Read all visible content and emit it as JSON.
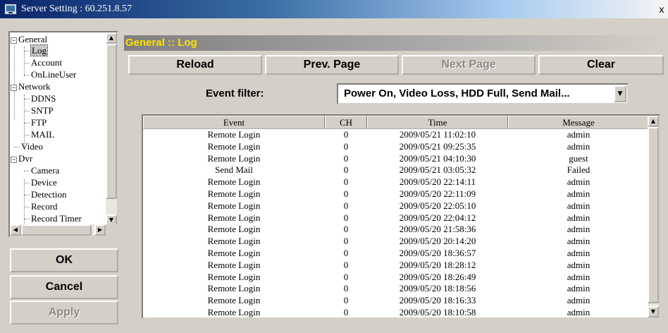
{
  "window": {
    "title": "Server Setting : 60.251.8.57",
    "close_glyph": "x"
  },
  "tree": {
    "nodes": [
      {
        "label": "General",
        "expander": "−"
      },
      {
        "label": "Log"
      },
      {
        "label": "Account"
      },
      {
        "label": "OnLineUser"
      },
      {
        "label": "Network",
        "expander": "−"
      },
      {
        "label": "DDNS"
      },
      {
        "label": "SNTP"
      },
      {
        "label": "FTP"
      },
      {
        "label": "MAIL"
      },
      {
        "label": "Video"
      },
      {
        "label": "Dvr",
        "expander": "−"
      },
      {
        "label": "Camera"
      },
      {
        "label": "Device"
      },
      {
        "label": "Detection"
      },
      {
        "label": "Record"
      },
      {
        "label": "Record Timer"
      }
    ],
    "selected": "Log"
  },
  "left_buttons": {
    "ok": "OK",
    "cancel": "Cancel",
    "apply": "Apply"
  },
  "section": {
    "header": "General :: Log"
  },
  "toolbar": {
    "reload": "Reload",
    "prev_page": "Prev. Page",
    "next_page": "Next Page",
    "clear": "Clear"
  },
  "filter": {
    "label": "Event filter:",
    "value": "Power On, Video Loss, HDD Full, Send Mail..."
  },
  "log_table": {
    "columns": [
      "Event",
      "CH",
      "Time",
      "Message"
    ],
    "rows": [
      [
        "Remote Login",
        "0",
        "2009/05/21 11:02:10",
        "admin"
      ],
      [
        "Remote Login",
        "0",
        "2009/05/21 09:25:35",
        "admin"
      ],
      [
        "Remote Login",
        "0",
        "2009/05/21 04:10:30",
        "guest"
      ],
      [
        "Send Mail",
        "0",
        "2009/05/21 03:05:32",
        "Failed"
      ],
      [
        "Remote Login",
        "0",
        "2009/05/20 22:14:11",
        "admin"
      ],
      [
        "Remote Login",
        "0",
        "2009/05/20 22:11:09",
        "admin"
      ],
      [
        "Remote Login",
        "0",
        "2009/05/20 22:05:10",
        "admin"
      ],
      [
        "Remote Login",
        "0",
        "2009/05/20 22:04:12",
        "admin"
      ],
      [
        "Remote Login",
        "0",
        "2009/05/20 21:58:36",
        "admin"
      ],
      [
        "Remote Login",
        "0",
        "2009/05/20 20:14:20",
        "admin"
      ],
      [
        "Remote Login",
        "0",
        "2009/05/20 18:36:57",
        "admin"
      ],
      [
        "Remote Login",
        "0",
        "2009/05/20 18:28:12",
        "admin"
      ],
      [
        "Remote Login",
        "0",
        "2009/05/20 18:26:49",
        "admin"
      ],
      [
        "Remote Login",
        "0",
        "2009/05/20 18:18:56",
        "admin"
      ],
      [
        "Remote Login",
        "0",
        "2009/05/20 18:16:33",
        "admin"
      ],
      [
        "Remote Login",
        "0",
        "2009/05/20 18:10:58",
        "admin"
      ]
    ]
  },
  "colors": {
    "header_text": "#ffe000",
    "face": "#d4d0c8",
    "title_dark": "#0a246a"
  }
}
